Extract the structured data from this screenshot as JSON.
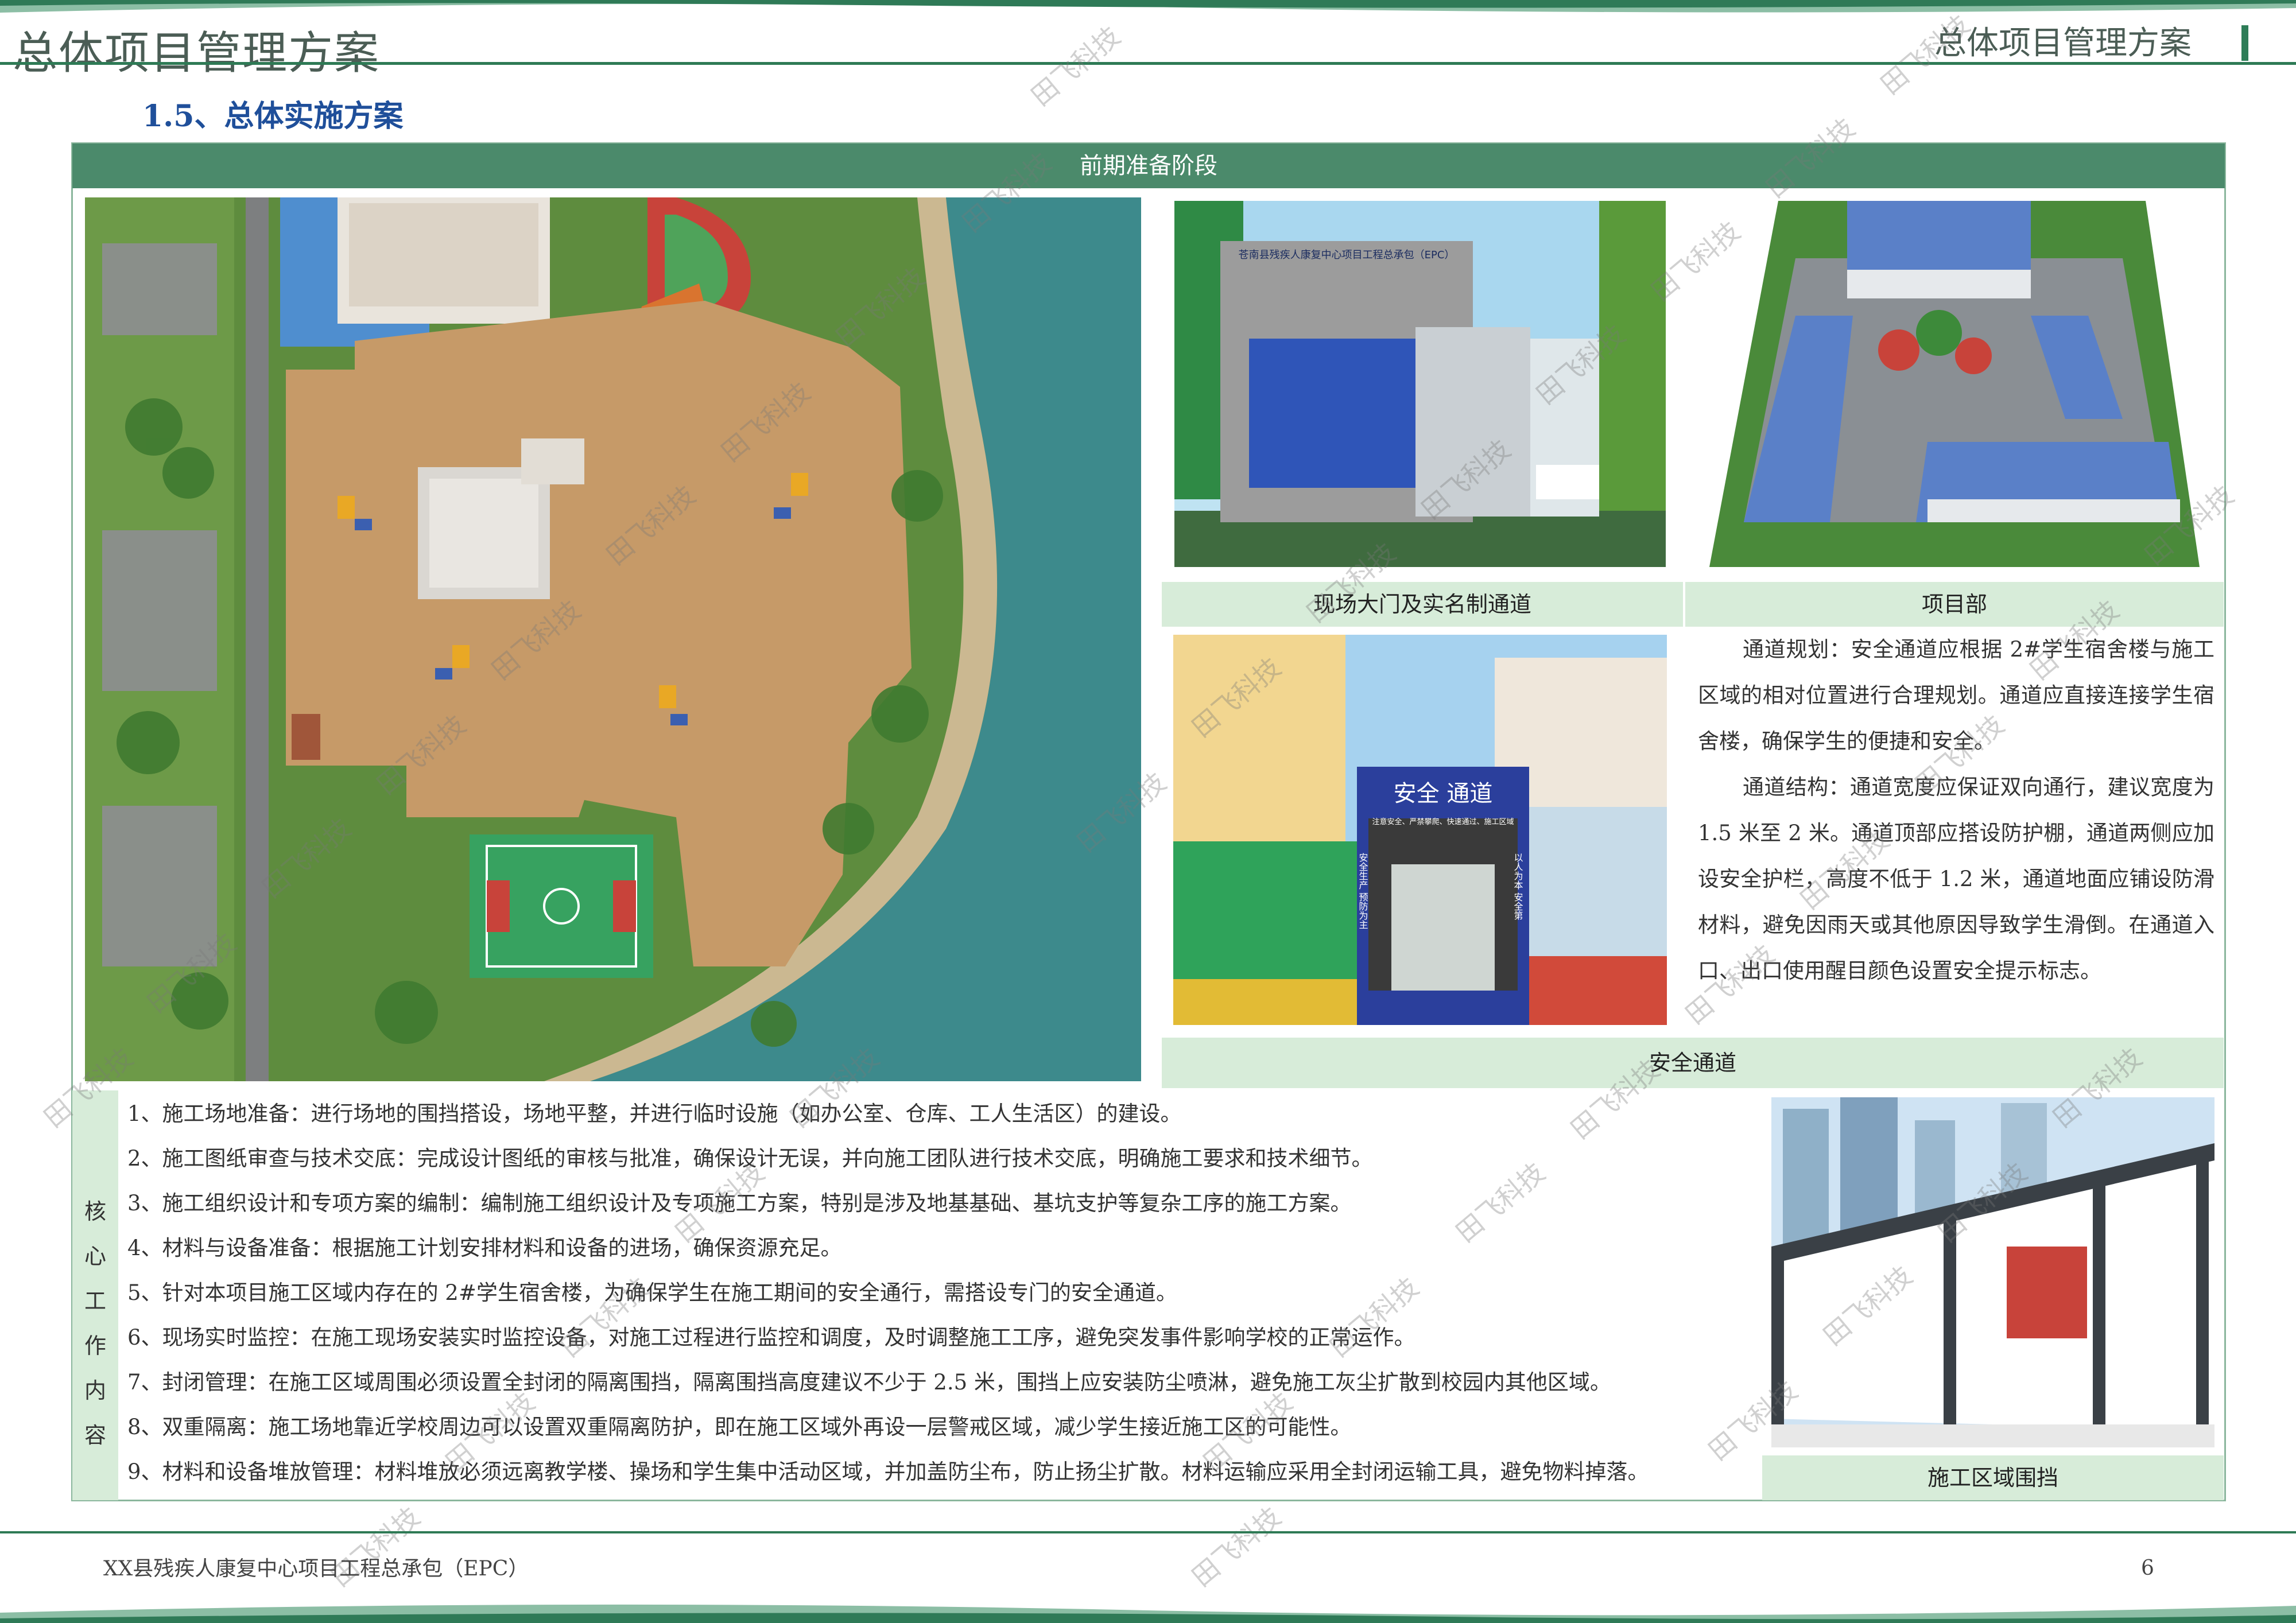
{
  "header": {
    "title_left": "总体项目管理方案",
    "title_right": "总体项目管理方案"
  },
  "section_title": "1.5、总体实施方案",
  "phase_title": "前期准备阶段",
  "captions": {
    "gate": "现场大门及实名制通道",
    "project_dept": "项目部",
    "safety_channel": "安全通道",
    "hoarding": "施工区域围挡"
  },
  "image_texts": {
    "gate_sign": "苍南县残疾人康复中心项目工程总承包（EPC）",
    "channel_sign": "安全 通道",
    "channel_sub": "注意安全、严禁攀爬、快速通过、施工区域",
    "channel_left": "安全生产 预防为主",
    "channel_right": "以人为本 安全第"
  },
  "channel_paragraphs": [
    "通道规划：安全通道应根据 2#学生宿舍楼与施工区域的相对位置进行合理规划。通道应直接连接学生宿舍楼，确保学生的便捷和安全。",
    "通道结构：通道宽度应保证双向通行，建议宽度为 1.5 米至 2 米。通道顶部应搭设防护棚，通道两侧应加设安全护栏，高度不低于 1.2 米，通道地面应铺设防滑材料，避免因雨天或其他原因导致学生滑倒。在通道入口、出口使用醒目颜色设置安全提示标志。"
  ],
  "core_label": [
    "核",
    "心",
    "工",
    "作",
    "内",
    "容"
  ],
  "core_items": [
    "1、施工场地准备：进行场地的围挡搭设，场地平整，并进行临时设施（如办公室、仓库、工人生活区）的建设。",
    "2、施工图纸审查与技术交底：完成设计图纸的审核与批准，确保设计无误，并向施工团队进行技术交底，明确施工要求和技术细节。",
    "3、施工组织设计和专项方案的编制：编制施工组织设计及专项施工方案，特别是涉及地基基础、基坑支护等复杂工序的施工方案。",
    "4、材料与设备准备：根据施工计划安排材料和设备的进场，确保资源充足。",
    "5、针对本项目施工区域内存在的 2#学生宿舍楼，为确保学生在施工期间的安全通行，需搭设专门的安全通道。",
    "6、现场实时监控：在施工现场安装实时监控设备，对施工过程进行监控和调度，及时调整施工工序，避免突发事件影响学校的正常运作。",
    "7、封闭管理：在施工区域周围必须设置全封闭的隔离围挡，隔离围挡高度建议不少于 2.5 米，围挡上应安装防尘喷淋，避免施工灰尘扩散到校园内其他区域。",
    "8、双重隔离：施工场地靠近学校周边可以设置双重隔离防护，即在施工区域外再设一层警戒区域，减少学生接近施工区的可能性。",
    "9、材料和设备堆放管理：材料堆放必须远离教学楼、操场和学生集中活动区域，并加盖防尘布，防止扬尘扩散。材料运输应采用全封闭运输工具，避免物料掉落。"
  ],
  "footer": {
    "project": "XX县残疾人康复中心项目工程总承包（EPC）",
    "page": "6"
  },
  "watermark": "田飞科技",
  "colors": {
    "green_header": "#4b8a6b",
    "light_green": "#d7ecd9",
    "title_blue": "#1f4f9a"
  }
}
